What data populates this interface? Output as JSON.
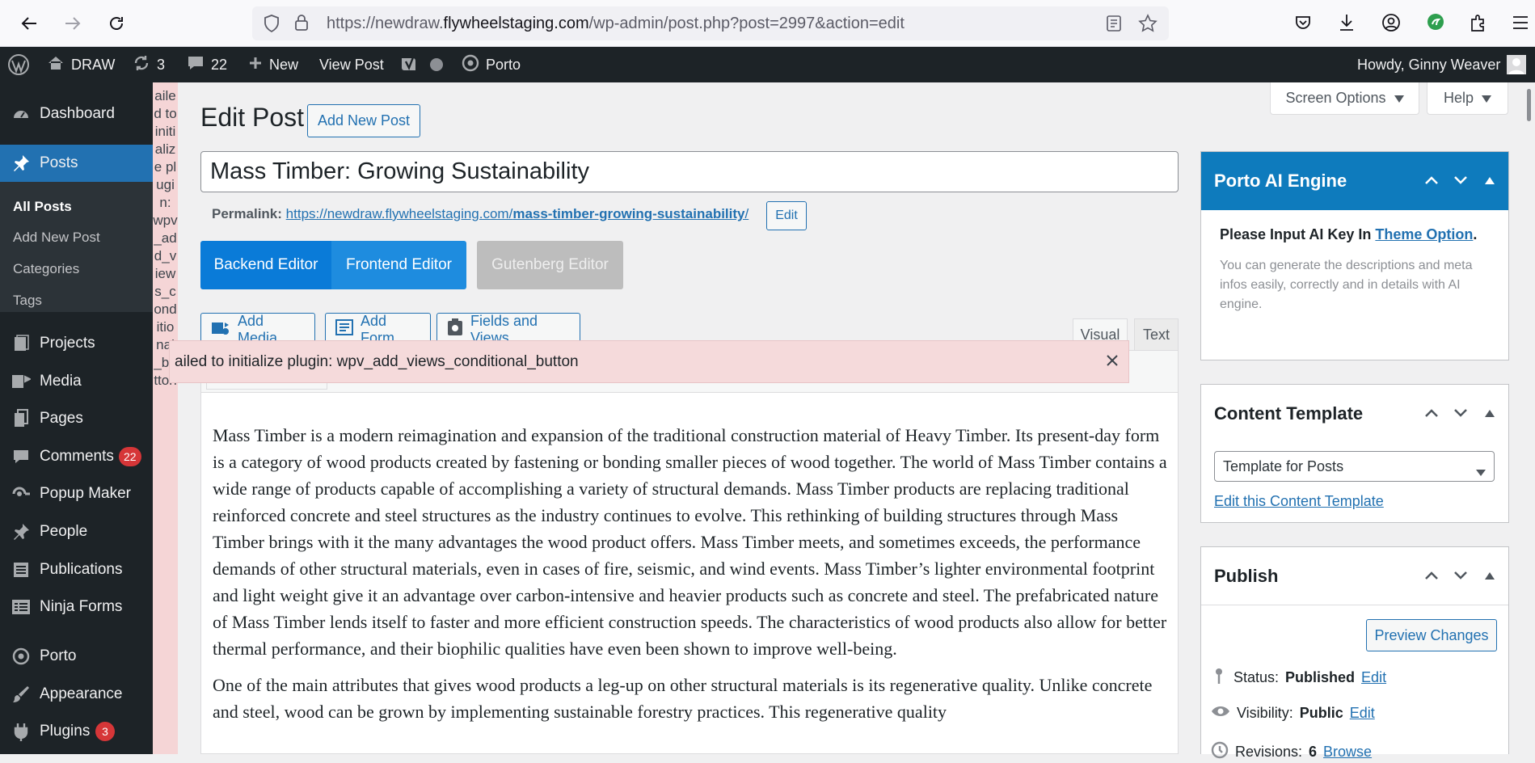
{
  "browser": {
    "url_prefix": "https://newdraw.",
    "url_domain": "flywheelstaging.com",
    "url_path": "/wp-admin/post.php?post=2997&action=edit"
  },
  "adminbar": {
    "site_name": "DRAW",
    "updates_count": "3",
    "comments_count": "22",
    "new_label": "New",
    "view_post_label": "View Post",
    "porto_label": "Porto",
    "howdy": "Howdy, Ginny Weaver"
  },
  "sidebar": {
    "items": [
      {
        "label": "Dashboard"
      },
      {
        "label": "Posts"
      },
      {
        "label": "Projects"
      },
      {
        "label": "Media"
      },
      {
        "label": "Pages"
      },
      {
        "label": "Comments",
        "badge": "22"
      },
      {
        "label": "Popup Maker"
      },
      {
        "label": "People"
      },
      {
        "label": "Publications"
      },
      {
        "label": "Ninja Forms"
      },
      {
        "label": "Porto"
      },
      {
        "label": "Appearance"
      },
      {
        "label": "Plugins",
        "badge": "3"
      }
    ],
    "submenu": [
      "All Posts",
      "Add New Post",
      "Categories",
      "Tags"
    ]
  },
  "vertical_error": "ailed to initialize plugin: wpv_add_views_conditional_button",
  "header": {
    "title": "Edit Post",
    "add_new": "Add New Post",
    "screen_options": "Screen Options",
    "help": "Help"
  },
  "post": {
    "title": "Mass Timber: Growing Sustainability",
    "permalink_label": "Permalink:",
    "permalink_base": "https://newdraw.flywheelstaging.com/",
    "permalink_slug": "mass-timber-growing-sustainability",
    "permalink_trailing": "/",
    "permalink_edit": "Edit"
  },
  "editor_switch": {
    "backend": "Backend Editor",
    "frontend": "Frontend Editor",
    "gutenberg": "Gutenberg Editor"
  },
  "media_buttons": {
    "add_media": "Add Media",
    "add_form": "Add Form",
    "fields_views": "Fields and Views"
  },
  "tabs": {
    "visual": "Visual",
    "text": "Text"
  },
  "error_bar": "ailed to initialize plugin: wpv_add_views_conditional_button",
  "content": {
    "p1": "Mass Timber is a modern reimagination and expansion of the traditional construction material of Heavy Timber. Its present-day form is a category of wood products created by fastening or bonding smaller pieces of wood together. The world of Mass Timber contains a wide range of products capable of accomplishing a variety of structural demands. Mass Timber products are replacing traditional reinforced concrete and steel structures as the industry continues to evolve. This rethinking of building structures through Mass Timber brings with it the many advantages the wood product offers. Mass Timber meets, and sometimes exceeds, the performance demands of other structural materials, even in cases of fire, seismic, and wind events. Mass Timber’s lighter environmental footprint and light weight give it an advantage over carbon-intensive and heavier products such as concrete and steel. The prefabricated nature of Mass Timber lends itself to faster and more efficient construction speeds. The characteristics of wood products also allow for better thermal performance, and their biophilic qualities have even been shown to improve well-being.",
    "p2": "One of the main attributes that gives wood products a leg-up on other structural materials is its regenerative quality. Unlike concrete and steel, wood can be grown by implementing sustainable forestry practices. This regenerative quality"
  },
  "porto_ai": {
    "title": "Porto AI Engine",
    "notice_prefix": "Please Input AI Key In ",
    "notice_link": "Theme Option",
    "notice_suffix": ".",
    "desc": "You can generate the descriptions and meta infos easily, correctly and in details with AI engine."
  },
  "content_template": {
    "title": "Content Template",
    "selected": "Template for Posts",
    "edit_link": "Edit this Content Template"
  },
  "publish": {
    "title": "Publish",
    "preview": "Preview Changes",
    "status_label": "Status:",
    "status_value": "Published",
    "visibility_label": "Visibility:",
    "visibility_value": "Public",
    "revisions_label": "Revisions:",
    "revisions_value": "6",
    "edit": "Edit",
    "browse": "Browse"
  },
  "colors": {
    "wp_dark": "#1d2327",
    "wp_blue": "#2271b1",
    "porto_blue": "#0e7bbd",
    "error_bg": "#f5dadb",
    "editor_active": "#0a7bd8"
  }
}
